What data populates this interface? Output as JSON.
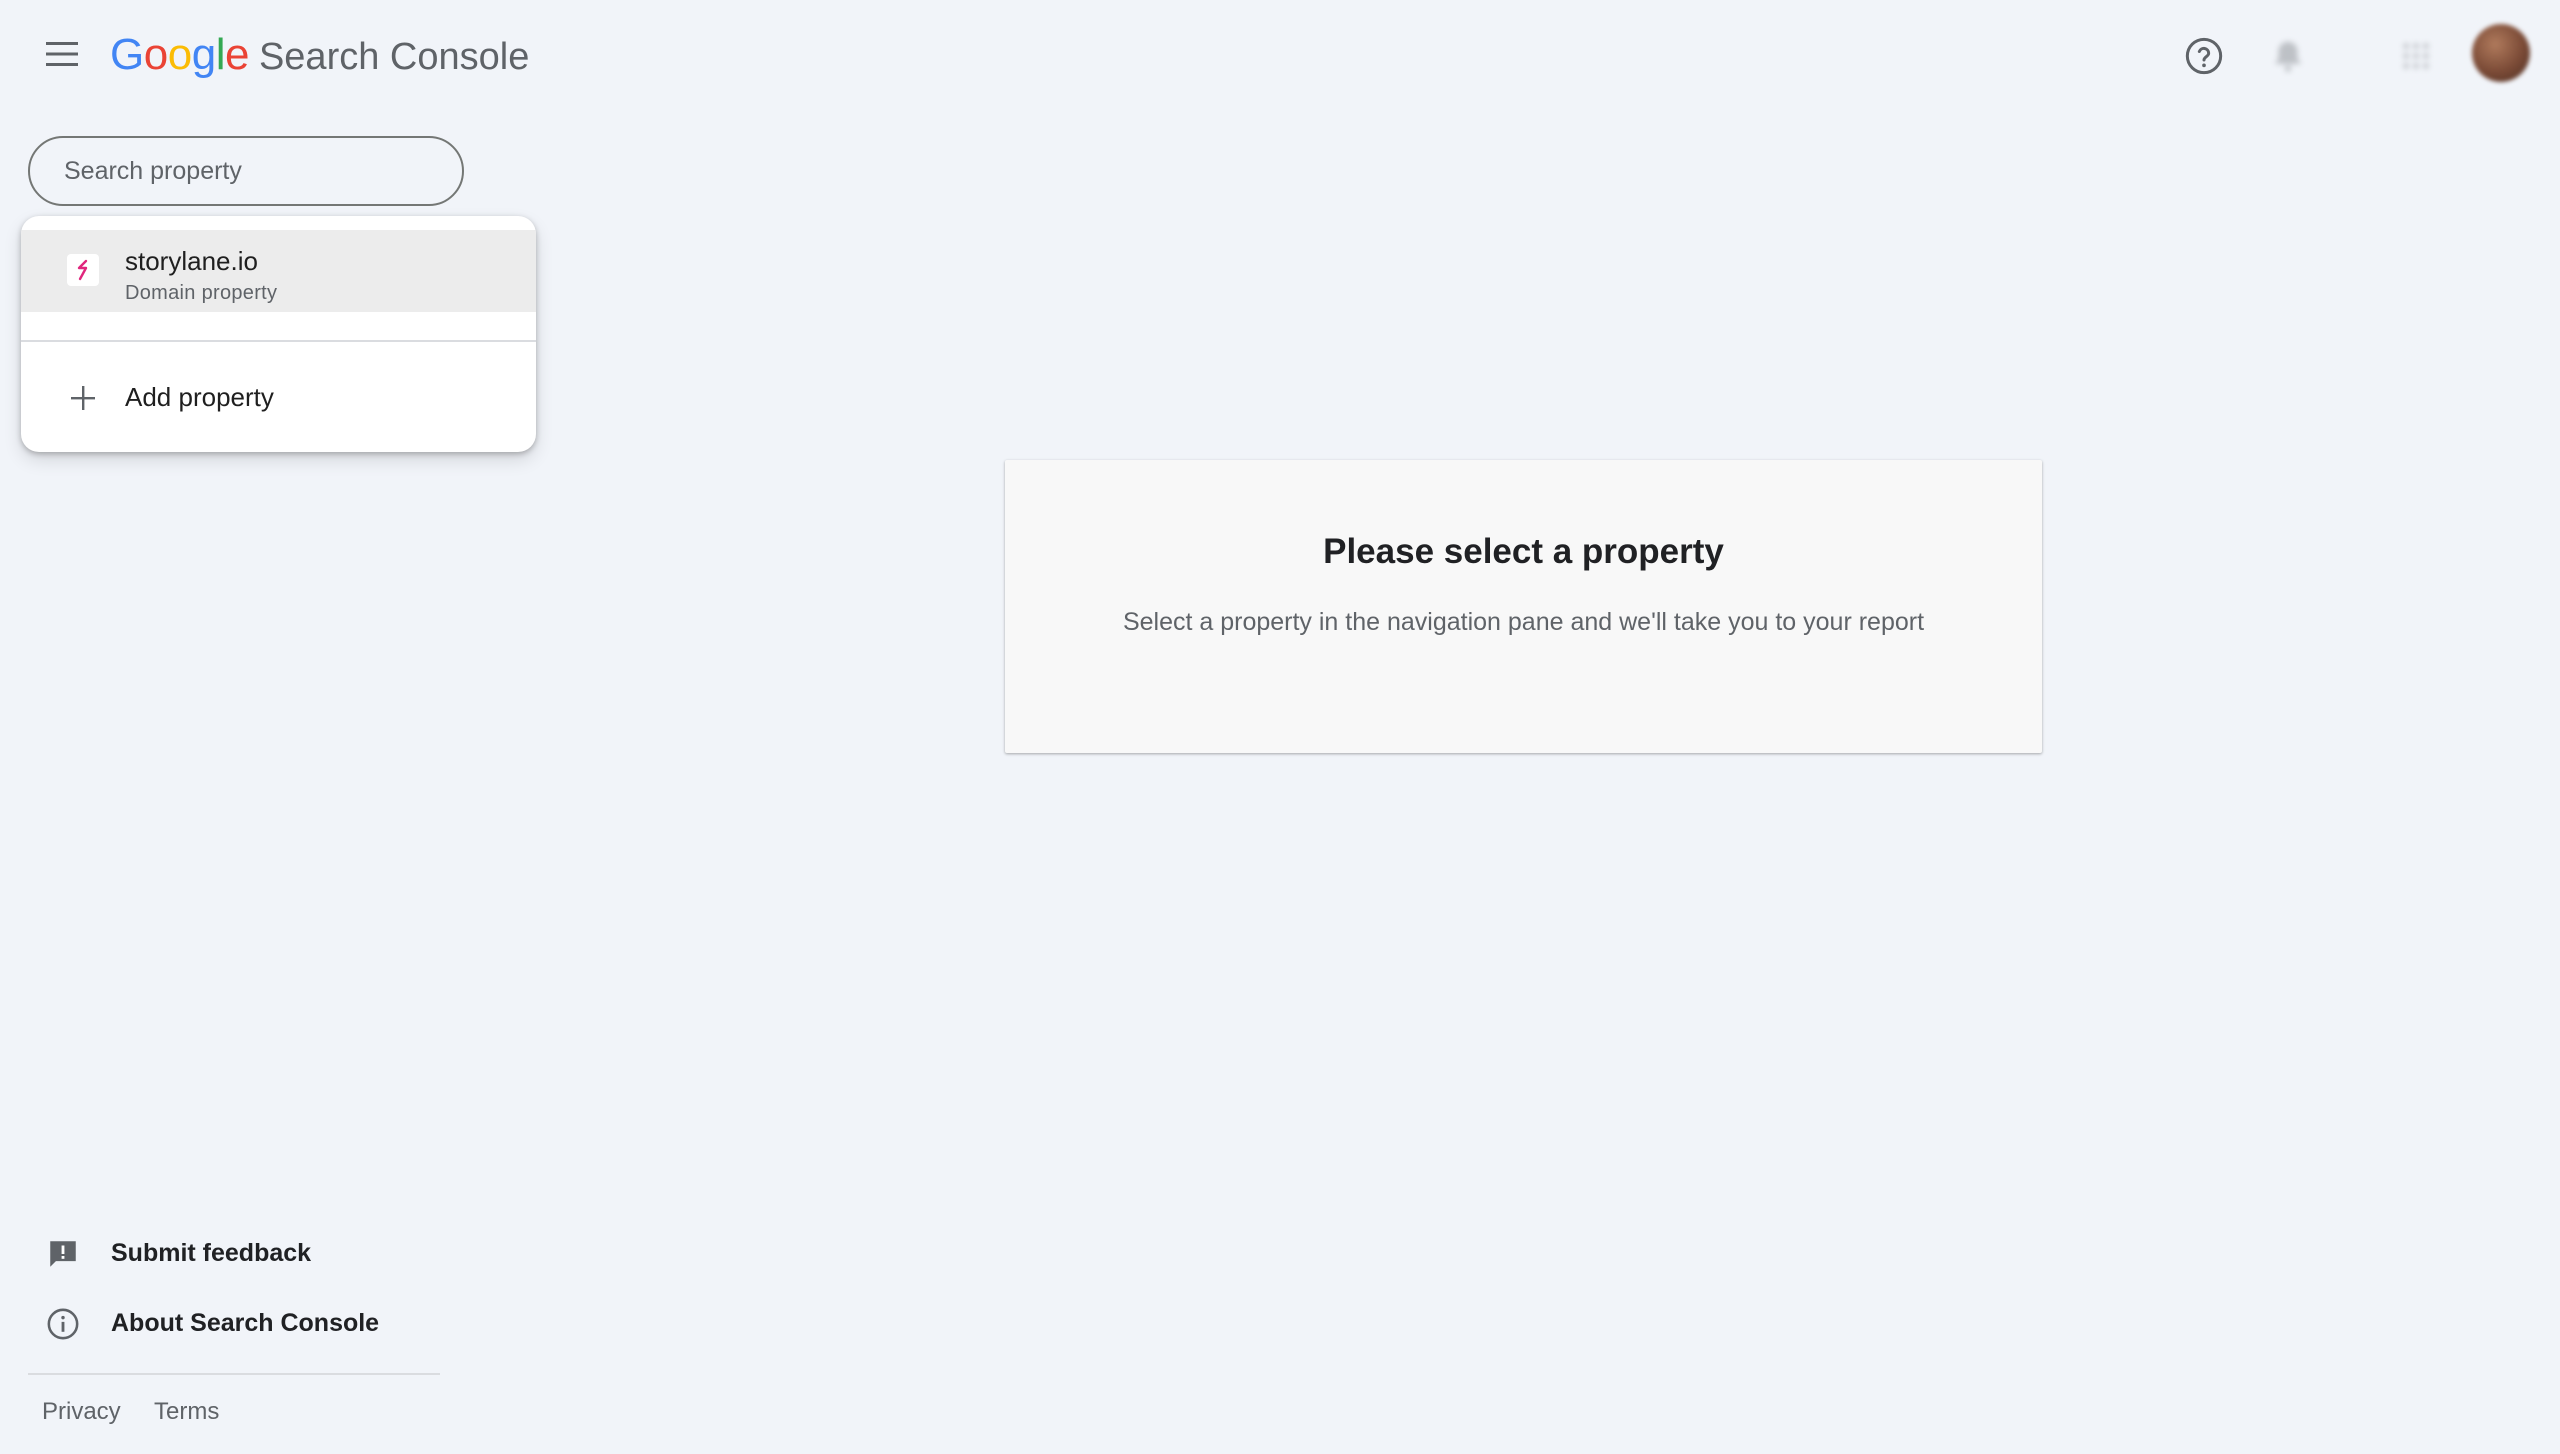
{
  "header": {
    "logo_word": "Google",
    "logo_letters": [
      "G",
      "o",
      "o",
      "g",
      "l",
      "e"
    ],
    "product_name": "Search Console"
  },
  "search": {
    "placeholder": "Search property",
    "value": ""
  },
  "dropdown": {
    "properties": [
      {
        "name": "storylane.io",
        "type": "Domain property"
      }
    ],
    "add_label": "Add property"
  },
  "main_card": {
    "title": "Please select a property",
    "subtitle": "Select a property in the navigation pane and we'll take you to your report"
  },
  "footer_nav": {
    "feedback_label": "Submit feedback",
    "about_label": "About Search Console",
    "privacy_label": "Privacy",
    "terms_label": "Terms"
  },
  "colors": {
    "background": "#f1f4f9",
    "google_blue": "#4285f4",
    "google_red": "#ea4335",
    "google_yellow": "#fbbc05",
    "google_green": "#34a853",
    "property_icon": "#e0267d"
  },
  "icons": [
    "menu-icon",
    "help-icon",
    "notifications-icon",
    "apps-icon",
    "property-favicon-icon",
    "plus-icon",
    "feedback-icon",
    "info-icon"
  ]
}
